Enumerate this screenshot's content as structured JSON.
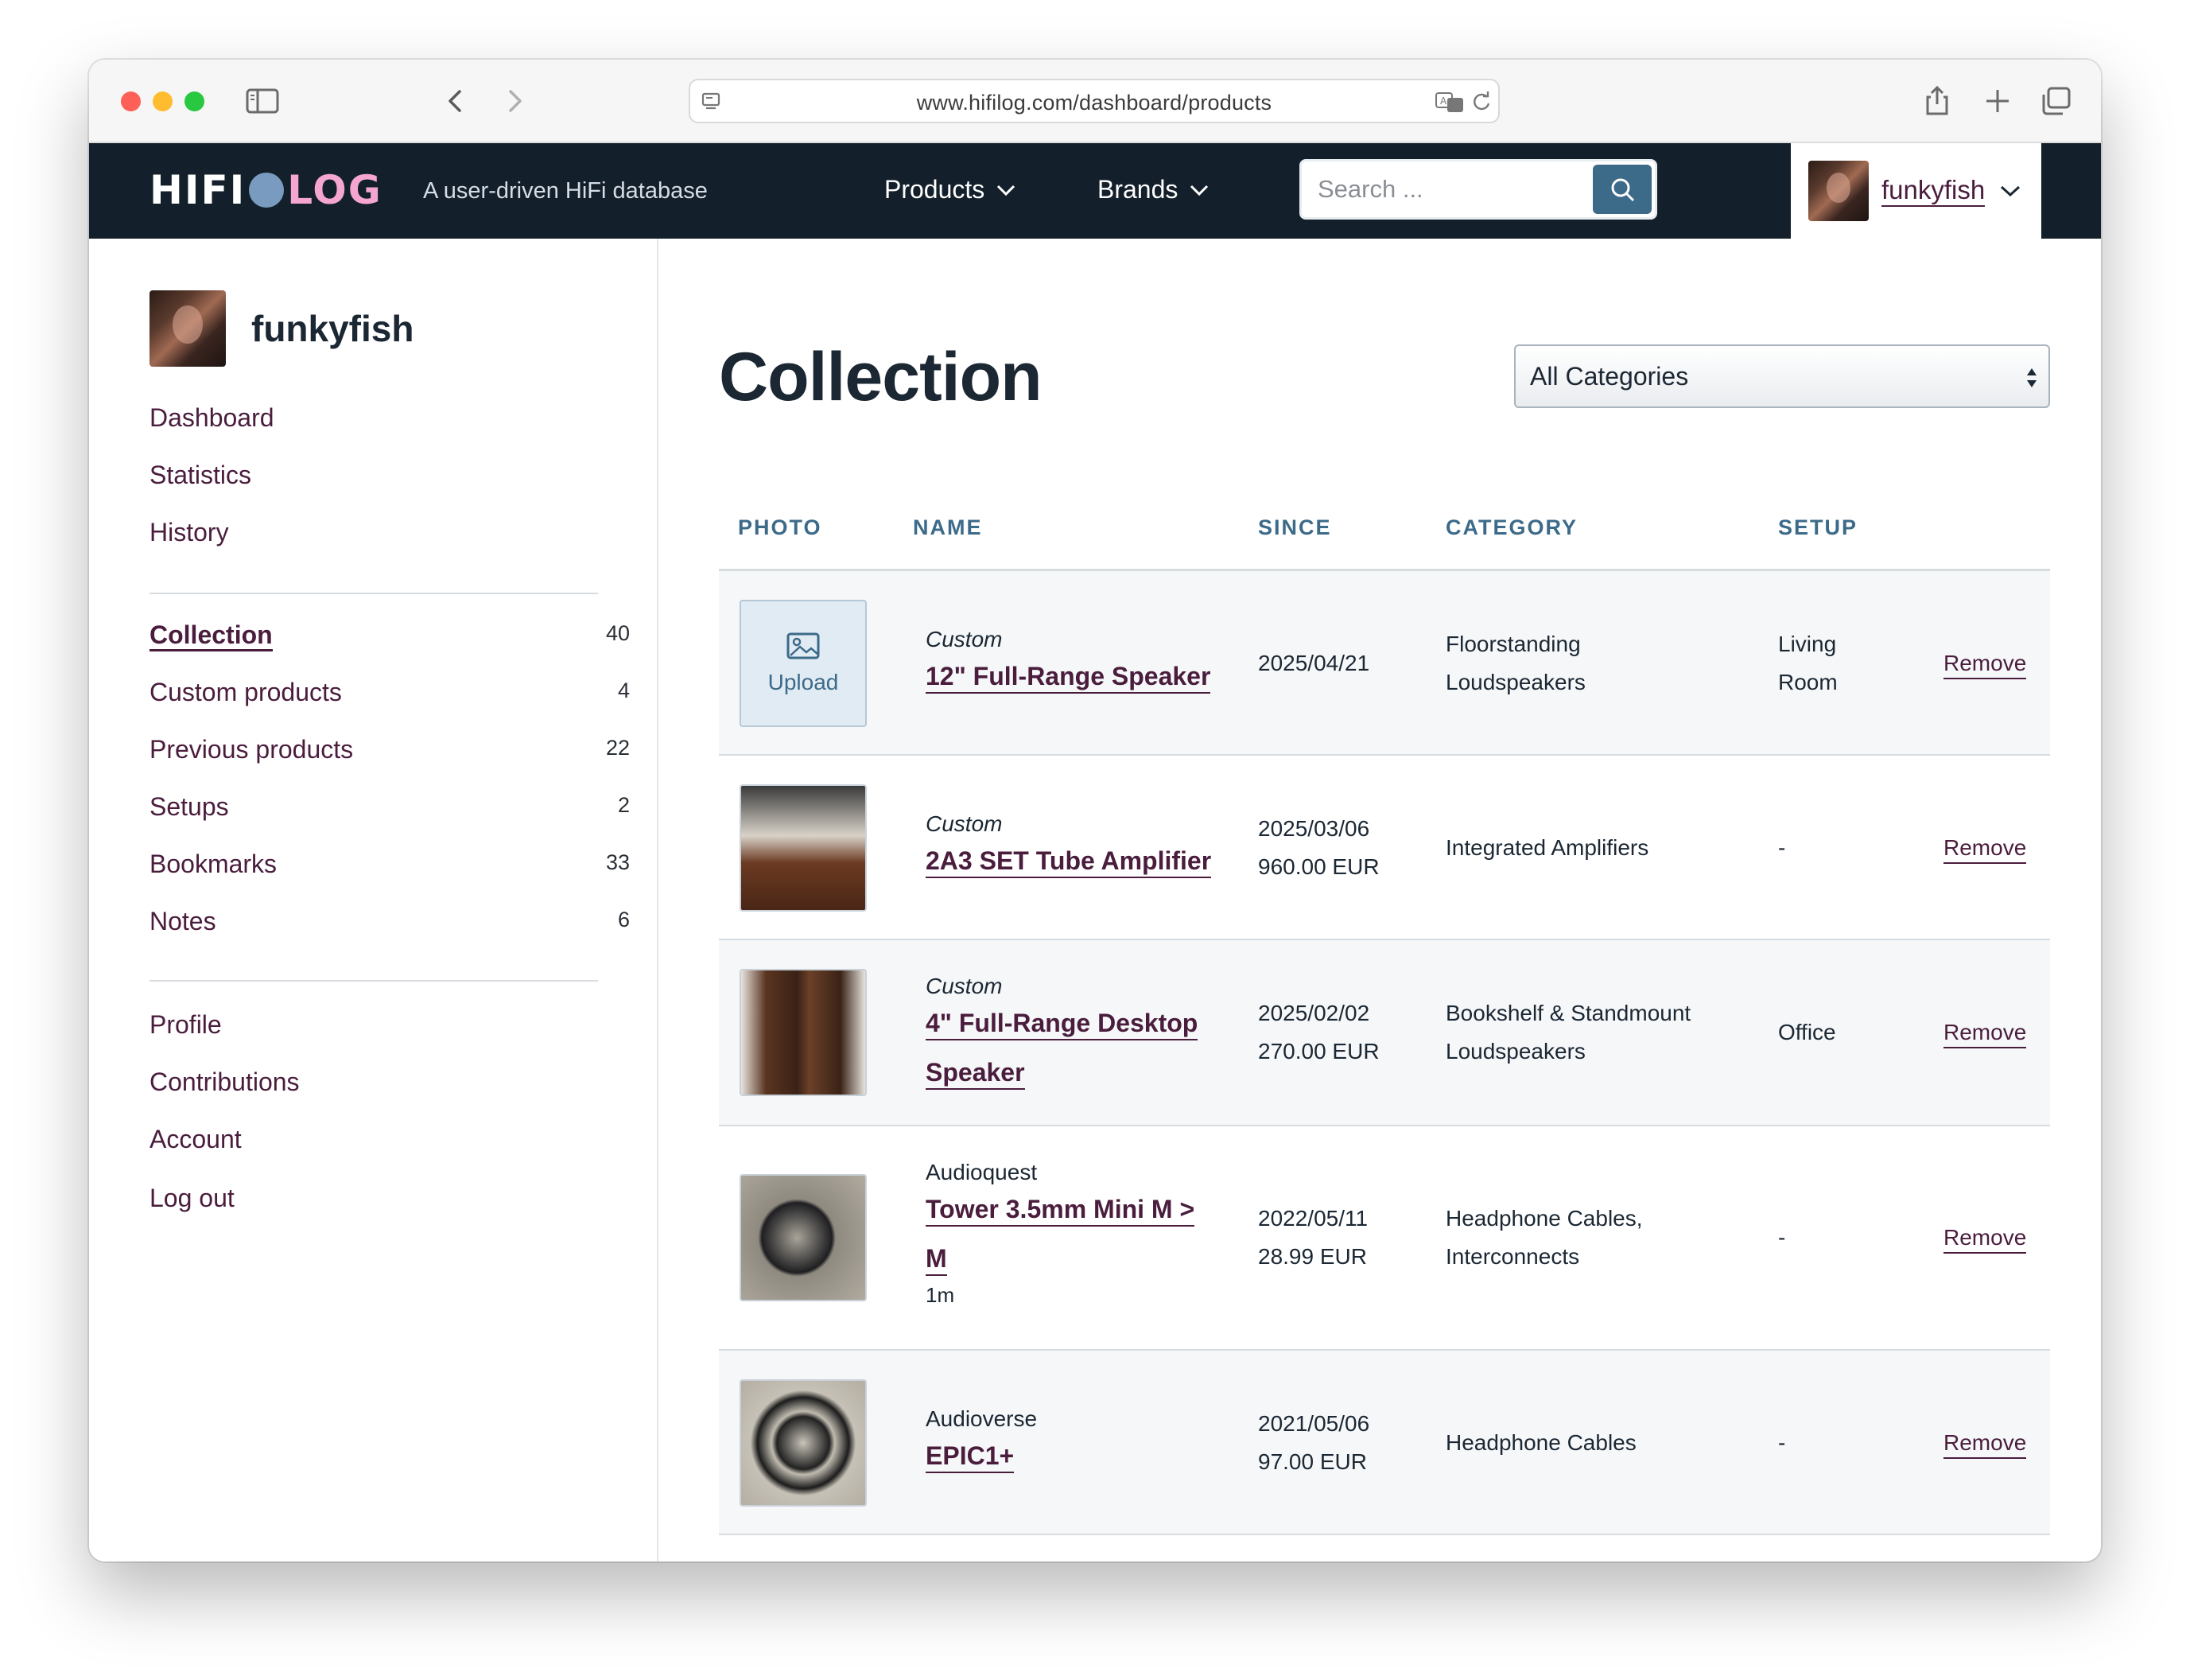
{
  "browser": {
    "url": "www.hifilog.com/dashboard/products"
  },
  "header": {
    "logo_left": "HIFI",
    "logo_right": "LOG",
    "tagline": "A user-driven HiFi database",
    "nav": [
      {
        "label": "Products"
      },
      {
        "label": "Brands"
      }
    ],
    "search_placeholder": "Search ...",
    "username": "funkyfish"
  },
  "sidebar": {
    "username": "funkyfish",
    "group1": [
      {
        "label": "Dashboard"
      },
      {
        "label": "Statistics"
      },
      {
        "label": "History"
      }
    ],
    "group2": [
      {
        "label": "Collection",
        "count": "40"
      },
      {
        "label": "Custom products",
        "count": "4"
      },
      {
        "label": "Previous products",
        "count": "22"
      },
      {
        "label": "Setups",
        "count": "2"
      },
      {
        "label": "Bookmarks",
        "count": "33"
      },
      {
        "label": "Notes",
        "count": "6"
      }
    ],
    "group3": [
      {
        "label": "Profile"
      },
      {
        "label": "Contributions"
      },
      {
        "label": "Account"
      },
      {
        "label": "Log out"
      }
    ]
  },
  "main": {
    "title": "Collection",
    "category_select": "All Categories",
    "columns": [
      "PHOTO",
      "NAME",
      "SINCE",
      "CATEGORY",
      "SETUP"
    ],
    "rows": [
      {
        "photo": "Upload",
        "brand": "Custom",
        "name": "12\" Full-Range Speaker",
        "since_date": "2025/04/21",
        "since_price": "",
        "category_line1": "Floorstanding",
        "category_line2": "Loudspeakers",
        "setup_line1": "Living",
        "setup_line2": "Room",
        "action": "Remove"
      },
      {
        "photo": "tube-amplifier",
        "brand": "Custom",
        "name": "2A3 SET Tube Amplifier",
        "since_date": "2025/03/06",
        "since_price": "960.00 EUR",
        "category_line1": "Integrated Amplifiers",
        "category_line2": "",
        "setup_line1": "-",
        "setup_line2": "",
        "action": "Remove"
      },
      {
        "photo": "desktop-speakers",
        "brand": "Custom",
        "name_line1": "4\" Full-Range Desktop",
        "name_line2": "Speaker",
        "since_date": "2025/02/02",
        "since_price": "270.00 EUR",
        "category_line1": "Bookshelf & Standmount",
        "category_line2": "Loudspeakers",
        "setup_line1": "Office",
        "setup_line2": "",
        "action": "Remove"
      },
      {
        "photo": "cable",
        "brand": "Audioquest",
        "name_line1": "Tower 3.5mm Mini M >",
        "name_line2": "M",
        "variant": "1m",
        "since_date": "2022/05/11",
        "since_price": "28.99 EUR",
        "category_line1": "Headphone Cables,",
        "category_line2": "Interconnects",
        "setup_line1": "-",
        "setup_line2": "",
        "action": "Remove"
      },
      {
        "photo": "braided-cable",
        "brand": "Audioverse",
        "name": "EPIC1+",
        "since_date": "2021/05/06",
        "since_price": "97.00 EUR",
        "category_line1": "Headphone Cables",
        "category_line2": "",
        "setup_line1": "-",
        "setup_line2": "",
        "action": "Remove"
      }
    ]
  },
  "colors": {
    "header_bg": "#13202b",
    "link": "#4a1d3d",
    "accent": "#3c6a89",
    "row_shade": "#f5f7f9"
  }
}
